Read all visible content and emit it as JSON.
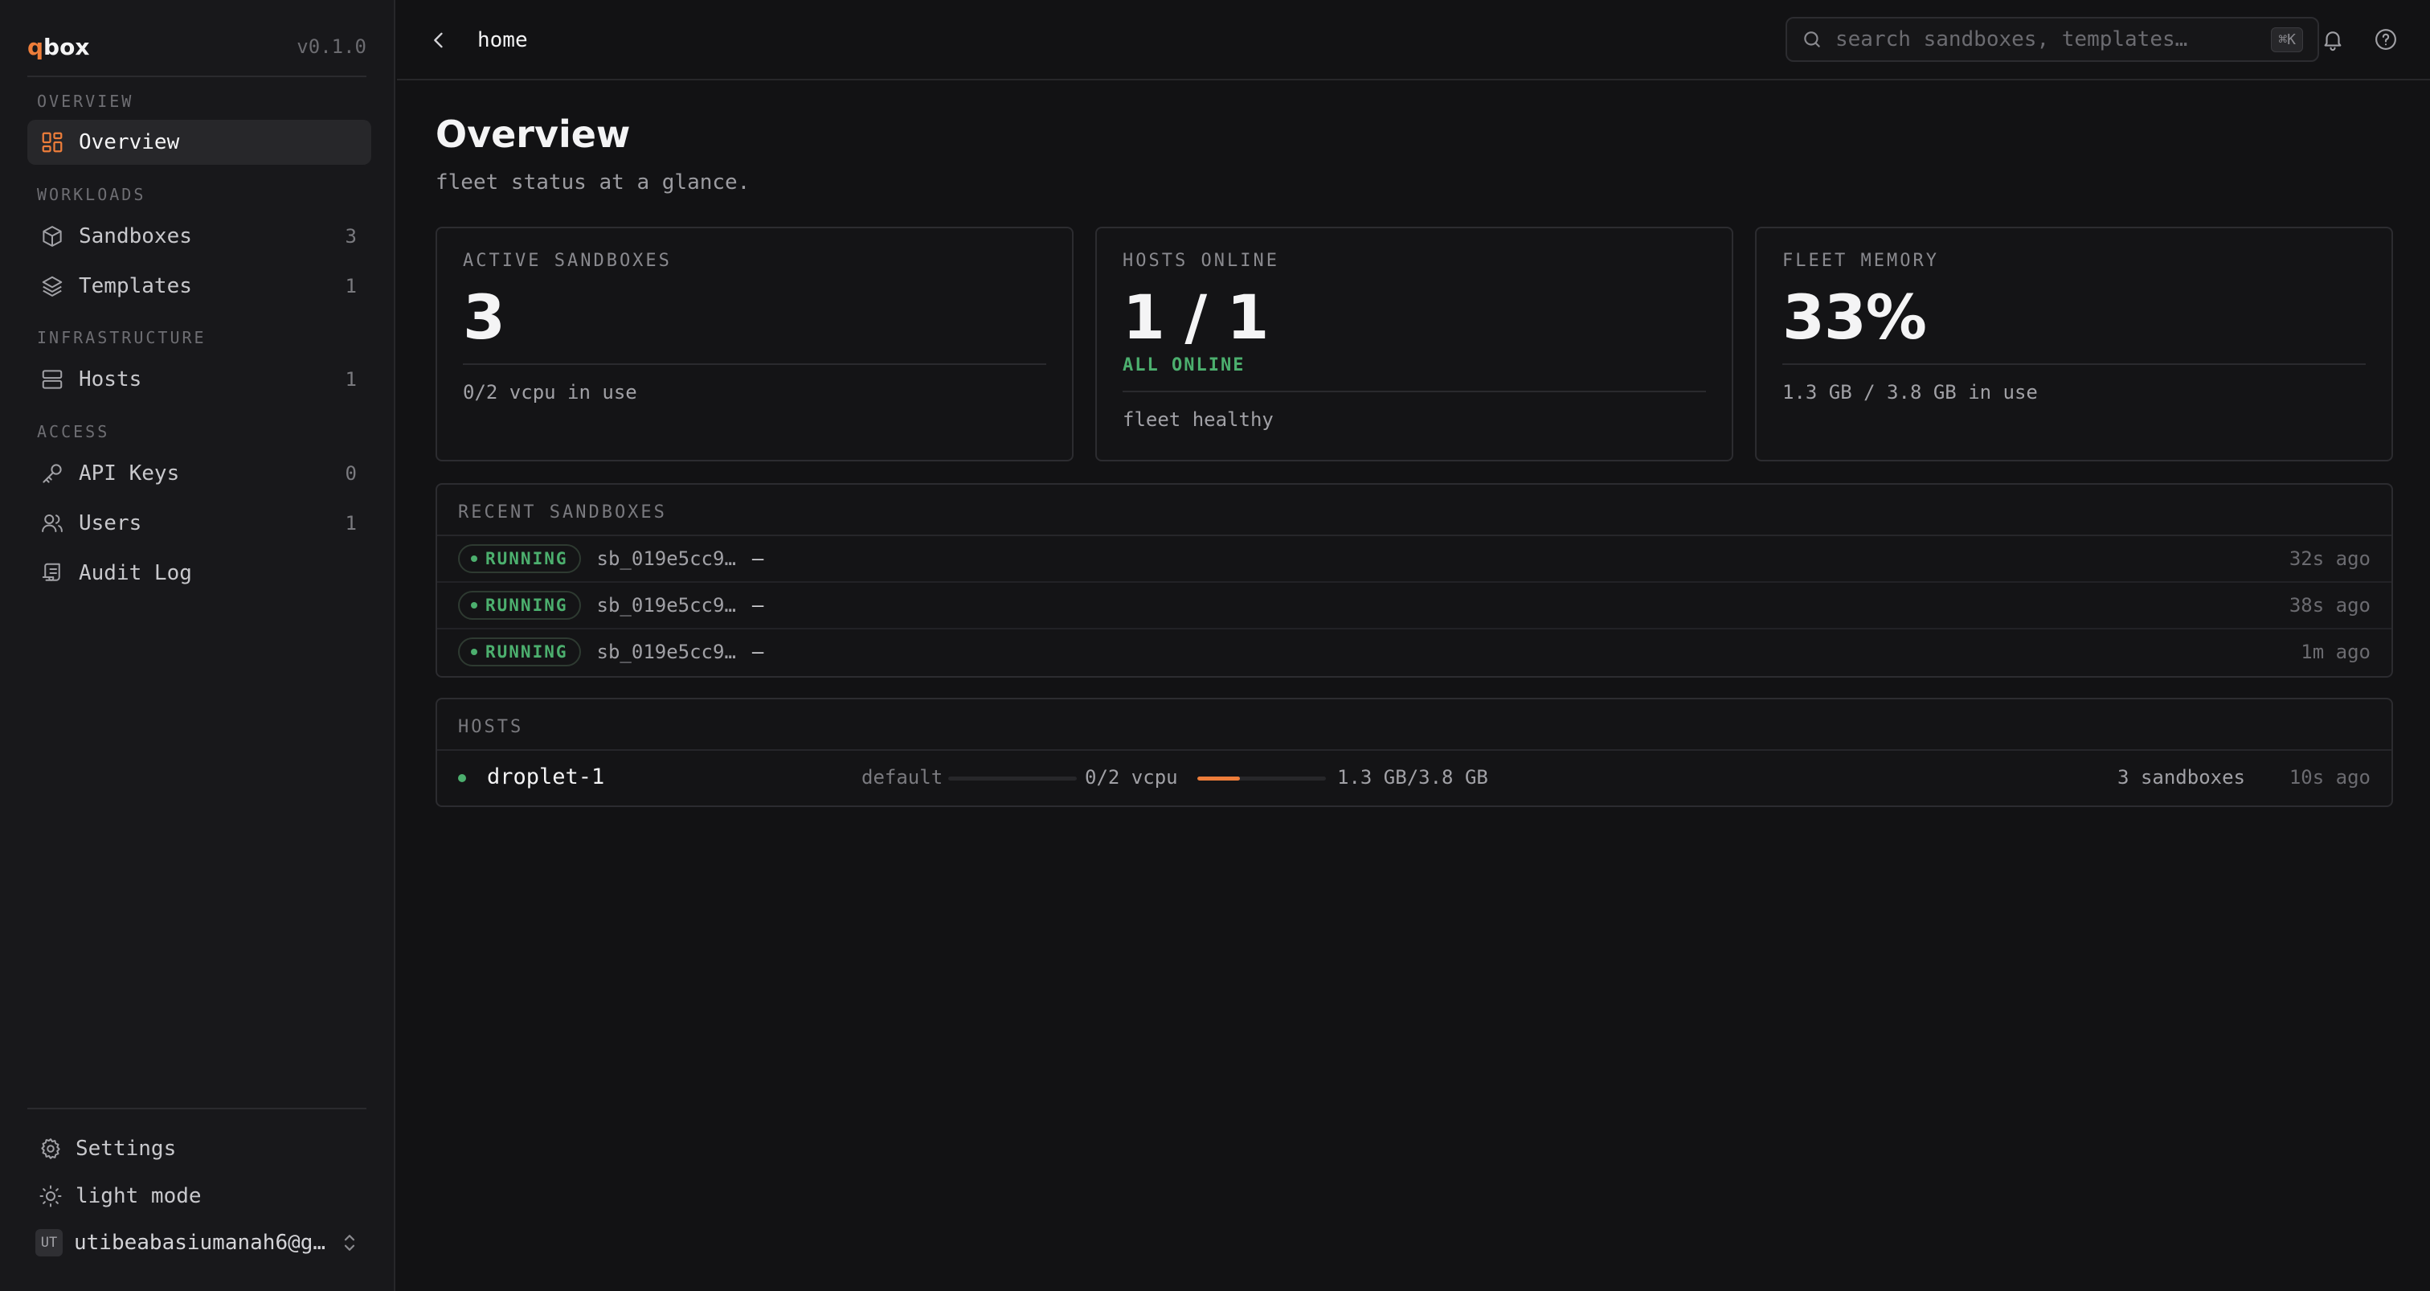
{
  "sidebar": {
    "brand_accent": "q",
    "brand_rest": "box",
    "version": "v0.1.0",
    "sections": {
      "overview": "OVERVIEW",
      "workloads": "WORKLOADS",
      "infrastructure": "INFRASTRUCTURE",
      "access": "ACCESS"
    },
    "items": {
      "overview": {
        "label": "Overview",
        "icon": "grid-icon",
        "active": true
      },
      "sandboxes": {
        "label": "Sandboxes",
        "count": "3",
        "icon": "cube-icon"
      },
      "templates": {
        "label": "Templates",
        "count": "1",
        "icon": "layers-icon"
      },
      "hosts": {
        "label": "Hosts",
        "count": "1",
        "icon": "server-icon"
      },
      "api_keys": {
        "label": "API Keys",
        "count": "0",
        "icon": "key-icon"
      },
      "users": {
        "label": "Users",
        "count": "1",
        "icon": "users-icon"
      },
      "audit_log": {
        "label": "Audit Log",
        "icon": "scroll-icon"
      }
    },
    "settings": {
      "label": "Settings",
      "icon": "gear-icon"
    },
    "theme_toggle": {
      "label": "light mode",
      "icon": "sun-icon"
    },
    "user": {
      "initials": "UT",
      "email": "utibeabasiumanah6@g…"
    }
  },
  "header": {
    "breadcrumb": "home",
    "search": {
      "placeholder": "search sandboxes, templates…",
      "shortcut": "⌘K"
    }
  },
  "main": {
    "title": "Overview",
    "subtitle": "fleet status at a glance.",
    "cards": {
      "active_sandboxes": {
        "label": "ACTIVE SANDBOXES",
        "value": "3",
        "footer": "0/2 vcpu in use"
      },
      "hosts_online": {
        "label": "HOSTS ONLINE",
        "value": "1 / 1",
        "status": "ALL ONLINE",
        "footer": "fleet healthy"
      },
      "fleet_memory": {
        "label": "FLEET MEMORY",
        "value": "33%",
        "footer": "1.3 GB / 3.8 GB in use"
      }
    },
    "recent_sandboxes": {
      "label": "RECENT SANDBOXES",
      "rows": [
        {
          "status": "RUNNING",
          "id": "sb_019e5cc9…",
          "template": "—",
          "time": "32s ago"
        },
        {
          "status": "RUNNING",
          "id": "sb_019e5cc9…",
          "template": "—",
          "time": "38s ago"
        },
        {
          "status": "RUNNING",
          "id": "sb_019e5cc9…",
          "template": "—",
          "time": "1m ago"
        }
      ]
    },
    "hosts": {
      "label": "HOSTS",
      "rows": [
        {
          "name": "droplet-1",
          "pool": "default",
          "cpu_usage": 0,
          "cpu": "0/2 vcpu",
          "mem_usage": 0.33,
          "mem": "1.3 GB/3.8 GB",
          "sandboxes": "3 sandboxes",
          "time": "10s ago"
        }
      ]
    }
  },
  "colors": {
    "accent": "#ed7d3a",
    "success": "#4caf6e",
    "background": "#121214",
    "sidebar": "#18181b"
  }
}
